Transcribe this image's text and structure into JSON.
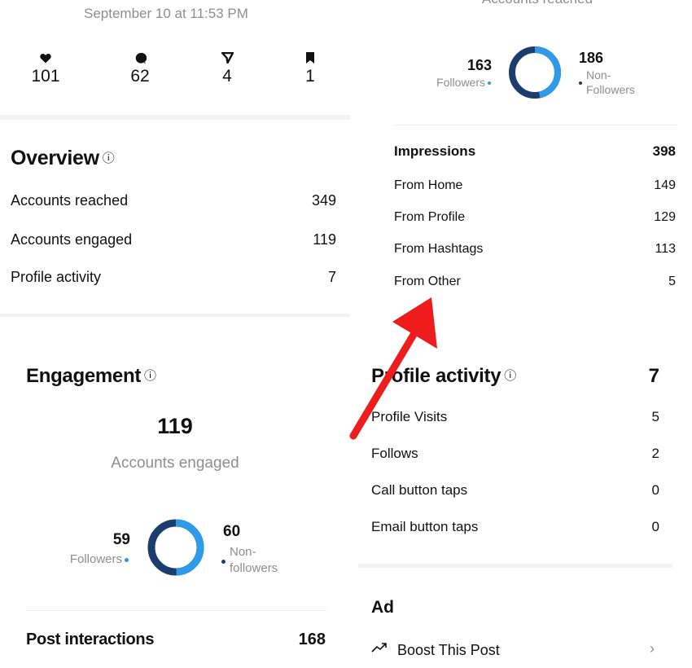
{
  "post_header": {
    "date": "September 10 at 11:53 PM"
  },
  "post_stats": [
    {
      "icon": "heart-icon",
      "value": "101"
    },
    {
      "icon": "comment-icon",
      "value": "62"
    },
    {
      "icon": "share-icon",
      "value": "4"
    },
    {
      "icon": "bookmark-icon",
      "value": "1"
    }
  ],
  "overview": {
    "title": "Overview",
    "rows": [
      {
        "label": "Accounts reached",
        "value": "349"
      },
      {
        "label": "Accounts engaged",
        "value": "119"
      },
      {
        "label": "Profile activity",
        "value": "7"
      }
    ]
  },
  "engagement": {
    "title": "Engagement",
    "total": "119",
    "subtitle": "Accounts engaged",
    "followers": {
      "value": "59",
      "label": "Followers"
    },
    "non_followers": {
      "value": "60",
      "label_line1": "Non-",
      "label_line2": "followers"
    },
    "donut": {
      "followers_fraction": 0.496
    },
    "post_interactions": {
      "label": "Post interactions",
      "value": "168"
    }
  },
  "reach": {
    "subtitle": "Accounts reached",
    "followers": {
      "value": "163",
      "label": "Followers"
    },
    "non_followers": {
      "value": "186",
      "label_line1": "Non-",
      "label_line2": "Followers"
    },
    "donut": {
      "followers_fraction": 0.467
    },
    "impressions": {
      "label": "Impressions",
      "value": "398"
    },
    "sources": [
      {
        "label": "From Home",
        "value": "149"
      },
      {
        "label": "From Profile",
        "value": "129"
      },
      {
        "label": "From Hashtags",
        "value": "113"
      },
      {
        "label": "From Other",
        "value": "5"
      }
    ]
  },
  "profile_activity": {
    "title": "Profile activity",
    "total": "7",
    "rows": [
      {
        "label": "Profile Visits",
        "value": "5"
      },
      {
        "label": "Follows",
        "value": "2"
      },
      {
        "label": "Call button taps",
        "value": "0"
      },
      {
        "label": "Email button taps",
        "value": "0"
      }
    ]
  },
  "ad": {
    "title": "Ad",
    "boost_label": "Boost This Post"
  },
  "colors": {
    "followers_light": "#2f9ae8",
    "followers_dark": "#1b3d6e",
    "arrow": "#ee1c1c"
  }
}
